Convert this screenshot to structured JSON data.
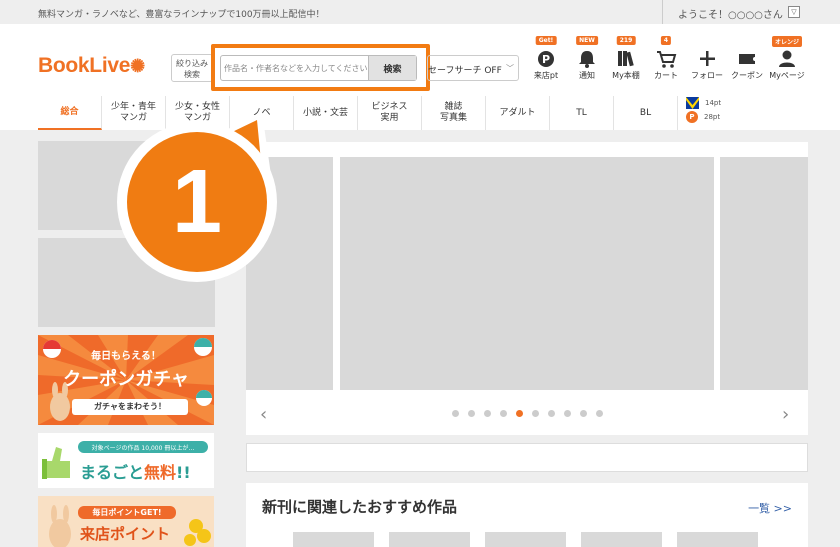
{
  "topbar": {
    "promo": "無料マンガ・ラノベなど、豊富なラインナップで100万冊以上配信中！",
    "welcome": "ようこそ！○○○○さん",
    "dropdown_glyph": "▽"
  },
  "header": {
    "logo": "BookLive",
    "filter_label_1": "絞り込み",
    "filter_label_2": "検索",
    "search_placeholder": "作品名・作者名などを入力してください",
    "search_button": "検索",
    "safe_search": "セーフサーチ OFF",
    "icons": [
      {
        "badge": "Get!",
        "label": "来店pt"
      },
      {
        "badge": "NEW",
        "label": "通知"
      },
      {
        "badge": "219",
        "label": "My本棚"
      },
      {
        "badge": "4",
        "label": "カート"
      },
      {
        "badge": "",
        "label": "フォロー"
      },
      {
        "badge": "",
        "label": "クーポン"
      },
      {
        "badge": "オレンジ",
        "label": "Myページ"
      }
    ]
  },
  "nav": {
    "items": [
      {
        "l1": "総合",
        "l2": ""
      },
      {
        "l1": "少年・青年",
        "l2": "マンガ"
      },
      {
        "l1": "少女・女性",
        "l2": "マンガ"
      },
      {
        "l1": "ノベ",
        "l2": ""
      },
      {
        "l1": "小説・文芸",
        "l2": ""
      },
      {
        "l1": "ビジネス",
        "l2": "実用"
      },
      {
        "l1": "雑誌",
        "l2": "写真集"
      },
      {
        "l1": "アダルト",
        "l2": ""
      },
      {
        "l1": "TL",
        "l2": ""
      },
      {
        "l1": "BL",
        "l2": ""
      }
    ],
    "tpoint": "14pt",
    "ppoint": "28pt"
  },
  "banners": {
    "coupon_top": "毎日もらえる！",
    "coupon_main": "クーポンガチャ",
    "coupon_sub": "ガチャをまわそう！",
    "free_top": "対象ページの作品 10,000 冊以上が…",
    "free_main_1": "まるごと",
    "free_main_2": "無料",
    "free_main_3": "!!",
    "visit_top": "毎日ポイントGET!",
    "visit_main": "来店ポイント"
  },
  "slider": {
    "prev": "‹",
    "next": "›",
    "dot_count": 10,
    "active_dot": 4
  },
  "reco": {
    "title": "新刊に関連したおすすめ作品",
    "more": "一覧 >>"
  },
  "callout": {
    "number": "1"
  },
  "colors": {
    "brand_orange": "#f07124",
    "callout_orange": "#f07c12",
    "link_blue": "#3561a8"
  }
}
